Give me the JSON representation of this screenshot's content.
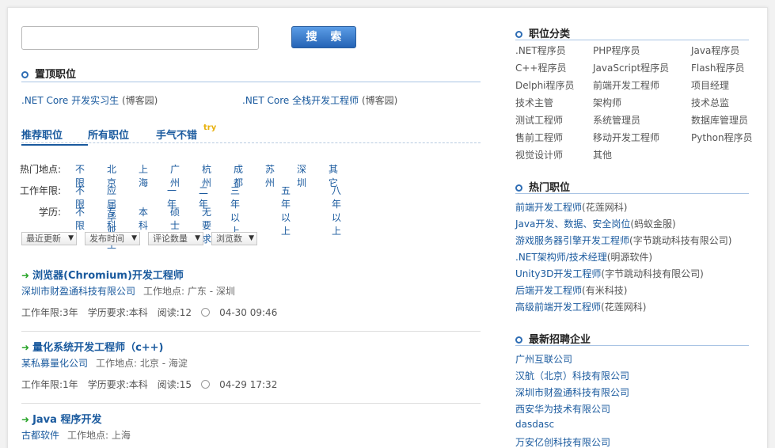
{
  "search": {
    "input_value": "",
    "button_label": "搜 索"
  },
  "top_jobs": {
    "title": "置顶职位",
    "items": [
      {
        "title": ".NET Core 开发实习生",
        "company": "(博客园)"
      },
      {
        "title": ".NET Core 全栈开发工程师",
        "company": "(博客园)"
      }
    ]
  },
  "tabs": {
    "recommended": "推荐职位",
    "all": "所有职位",
    "lucky": "手气不错",
    "lucky_badge": "try"
  },
  "filters": {
    "location": {
      "label": "热门地点:",
      "options": [
        "不限",
        "北京",
        "上海",
        "广州",
        "杭州",
        "成都",
        "苏州",
        "深圳",
        "其它"
      ]
    },
    "experience": {
      "label": "工作年限:",
      "options": [
        "不限",
        "应届毕业生",
        "一年",
        "二年",
        "三年以上",
        "五年以上",
        "八年以上"
      ]
    },
    "education": {
      "label": "学历:",
      "options": [
        "不限",
        "专科",
        "本科",
        "硕士",
        "无要求"
      ]
    }
  },
  "sort": [
    "最近更新",
    "发布时间",
    "评论数量",
    "浏览数"
  ],
  "jobs": [
    {
      "title": "浏览器(Chromium)开发工程师",
      "company": "深圳市财盈通科技有限公司",
      "location": "工作地点: 广东 - 深圳",
      "years": "工作年限:3年",
      "edu": "学历要求:本科",
      "reads": "阅读:12",
      "time": "04-30 09:46"
    },
    {
      "title": "量化系统开发工程师（c++)",
      "company": "某私募量化公司",
      "location": "工作地点: 北京 - 海淀",
      "years": "工作年限:1年",
      "edu": "学历要求:本科",
      "reads": "阅读:15",
      "time": "04-29 17:32"
    },
    {
      "title": "Java 程序开发",
      "company": "古都软件",
      "location": "工作地点: 上海",
      "years": "",
      "edu": "",
      "reads": "",
      "time": ""
    }
  ],
  "categories": {
    "title": "职位分类",
    "items": [
      ".NET程序员",
      "PHP程序员",
      "Java程序员",
      "C++程序员",
      "JavaScript程序员",
      "Flash程序员",
      "Delphi程序员",
      "前端开发工程师",
      "项目经理",
      "技术主管",
      "架构师",
      "技术总监",
      "测试工程师",
      "系统管理员",
      "数据库管理员",
      "售前工程师",
      "移动开发工程师",
      "Python程序员",
      "视觉设计师",
      "其他"
    ]
  },
  "hot_jobs": {
    "title": "热门职位",
    "items": [
      {
        "title": "前端开发工程师",
        "company": "(花莲网科)"
      },
      {
        "title": "Java开发、数据、安全岗位",
        "company": "(蚂蚁金服)"
      },
      {
        "title": "游戏服务器引擎开发工程师",
        "company": "(字节跳动科技有限公司)"
      },
      {
        "title": ".NET架构师/技术经理",
        "company": "(明源软件)"
      },
      {
        "title": "Unity3D开发工程师",
        "company": "(字节跳动科技有限公司)"
      },
      {
        "title": "后端开发工程师",
        "company": "(有米科技)"
      },
      {
        "title": "高级前端开发工程师",
        "company": "(花莲网科)"
      }
    ]
  },
  "new_companies": {
    "title": "最新招聘企业",
    "items": [
      "广州互联公司",
      "汉航（北京）科技有限公司",
      "深圳市财盈通科技有限公司",
      "西安华为技术有限公司",
      "dasdasc",
      "万安亿创科技有限公司"
    ]
  }
}
